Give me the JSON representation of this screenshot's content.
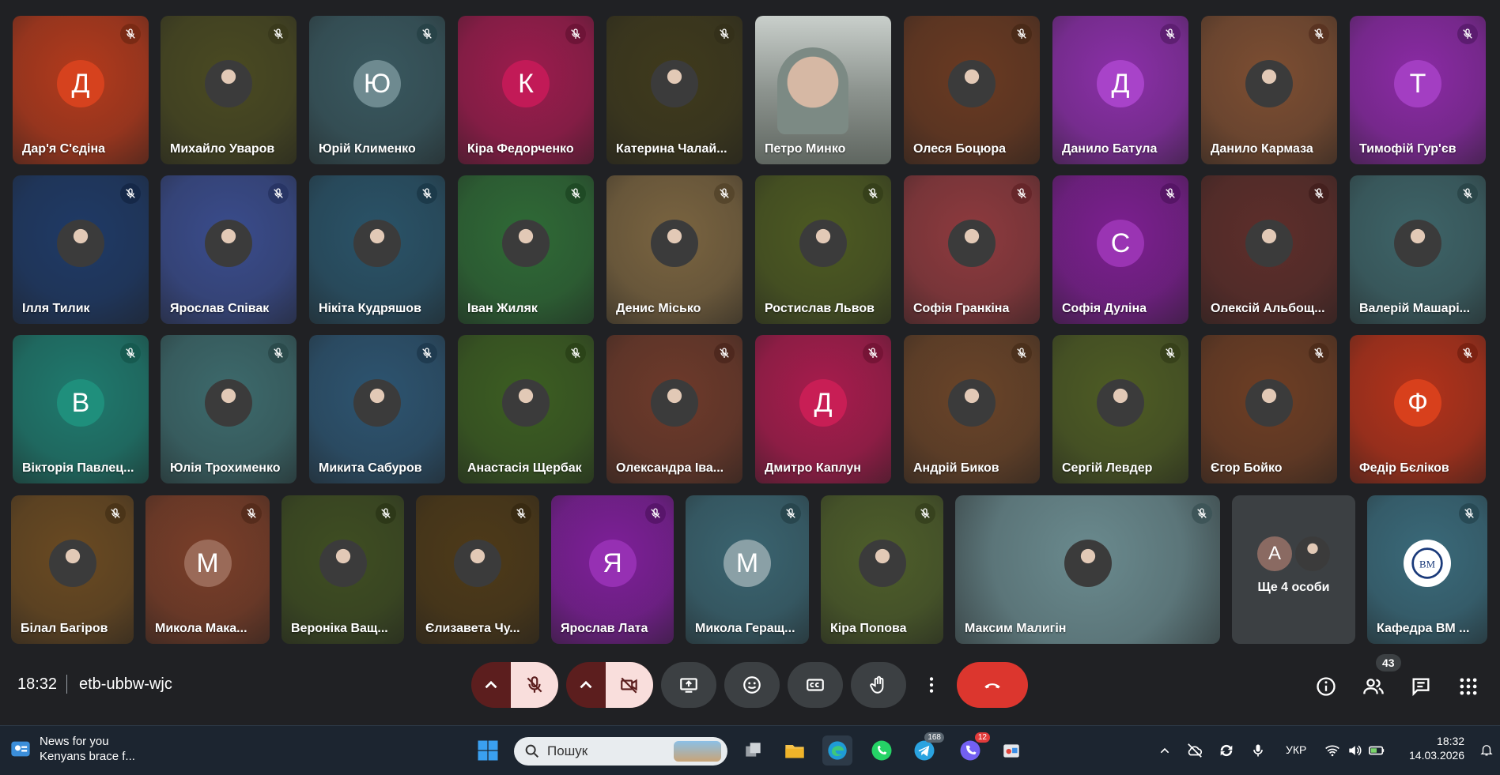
{
  "meeting": {
    "time": "18:32",
    "code": "etb-ubbw-wjc",
    "participant_count": "43",
    "more_people": {
      "label": "Ще 4 особи",
      "initial": "А"
    }
  },
  "rows": [
    [
      {
        "name": "Дар'я С'єдіна",
        "initial": "Д",
        "bg": "#b33a1c",
        "av": "#d6421e",
        "mic": "#7a2a14"
      },
      {
        "name": "Михайло Уваров",
        "initial": "",
        "bg": "#4a4a22",
        "av": "",
        "mic": "#3a3a1c"
      },
      {
        "name": "Юрій Клименко",
        "initial": "Ю",
        "bg": "#39585f",
        "av": "#6e8a90",
        "mic": "#284348"
      },
      {
        "name": "Кіра Федорченко",
        "initial": "К",
        "bg": "#9c1c4d",
        "av": "#c21a57",
        "mic": "#6e1437"
      },
      {
        "name": "Катерина Чалай...",
        "initial": "",
        "bg": "#3f3a1c",
        "av": "",
        "mic": "#34301a"
      },
      {
        "name": "Петро Минко",
        "initial": "",
        "bg": "#9da5a0",
        "av": "",
        "mic": ""
      },
      {
        "name": "Олеся Боцюра",
        "initial": "",
        "bg": "#6a3a22",
        "av": "",
        "mic": "#4a2a18"
      },
      {
        "name": "Данило Батула",
        "initial": "Д",
        "bg": "#8b2fa8",
        "av": "#a843c9",
        "mic": "#5e1f72"
      },
      {
        "name": "Данило Кармаза",
        "initial": "",
        "bg": "#7d4e32",
        "av": "",
        "mic": "#5a3422"
      },
      {
        "name": "Тимофій Гур'єв",
        "initial": "Т",
        "bg": "#8b2aa5",
        "av": "#a33ec2",
        "mic": "#5c1c70"
      }
    ],
    [
      {
        "name": "Ілля Тилик",
        "initial": "",
        "bg": "#1f3a66",
        "av": "",
        "mic": "#152848"
      },
      {
        "name": "Ярослав Співак",
        "initial": "",
        "bg": "#3a4c8c",
        "av": "",
        "mic": "#283565"
      },
      {
        "name": "Нікіта Кудряшов",
        "initial": "",
        "bg": "#2a5368",
        "av": "",
        "mic": "#1c3a4a"
      },
      {
        "name": "Іван Жиляк",
        "initial": "",
        "bg": "#2f6a36",
        "av": "",
        "mic": "#1f4a25"
      },
      {
        "name": "Денис Місько",
        "initial": "",
        "bg": "#7a6440",
        "av": "",
        "mic": "#56462c"
      },
      {
        "name": "Ростислав Львов",
        "initial": "",
        "bg": "#4d5a22",
        "av": "",
        "mic": "#36401a"
      },
      {
        "name": "Софія Гранкіна",
        "initial": "",
        "bg": "#8e3a3e",
        "av": "",
        "mic": "#66262a"
      },
      {
        "name": "Софія Дуліна",
        "initial": "С",
        "bg": "#7c1f90",
        "av": "#9a34b3",
        "mic": "#561566"
      },
      {
        "name": "Олексій Альбощ...",
        "initial": "",
        "bg": "#5e2e2a",
        "av": "",
        "mic": "#44201e"
      },
      {
        "name": "Валерій Машарі...",
        "initial": "",
        "bg": "#3e6468",
        "av": "",
        "mic": "#2b474a"
      }
    ],
    [
      {
        "name": "Вікторія Павлец...",
        "initial": "В",
        "bg": "#1f7a6e",
        "av": "#1f8f7c",
        "mic": "#165a50"
      },
      {
        "name": "Юлія Трохименко",
        "initial": "",
        "bg": "#3d6a6c",
        "av": "",
        "mic": "#2b4b4c"
      },
      {
        "name": "Микита Сабуров",
        "initial": "",
        "bg": "#2d5470",
        "av": "",
        "mic": "#1f3b50"
      },
      {
        "name": "Анастасія Щербак",
        "initial": "",
        "bg": "#3c5e22",
        "av": "",
        "mic": "#2b4318"
      },
      {
        "name": "Олександра Іва...",
        "initial": "",
        "bg": "#6e3a2a",
        "av": "",
        "mic": "#4e281e"
      },
      {
        "name": "Дмитро Каплун",
        "initial": "Д",
        "bg": "#a81c4d",
        "av": "#c81e55",
        "mic": "#761436"
      },
      {
        "name": "Андрій Биков",
        "initial": "",
        "bg": "#6a4428",
        "av": "",
        "mic": "#4b301c"
      },
      {
        "name": "Сергій Левдер",
        "initial": "",
        "bg": "#4e5c24",
        "av": "",
        "mic": "#37411a"
      },
      {
        "name": "Єгор Бойко",
        "initial": "",
        "bg": "#6e3e24",
        "av": "",
        "mic": "#4e2c1a"
      },
      {
        "name": "Федір Бєліков",
        "initial": "Ф",
        "bg": "#b3321a",
        "av": "#d8401c",
        "mic": "#7c2212"
      }
    ],
    [
      {
        "name": "Білал Багіров",
        "initial": "",
        "bg": "#6a4a22",
        "av": "",
        "mic": "#4a3418"
      },
      {
        "name": "Микола Мака...",
        "initial": "М",
        "bg": "#7a3e28",
        "av": "#9a6a58",
        "mic": "#562c1c"
      },
      {
        "name": "Вероніка Ващ...",
        "initial": "",
        "bg": "#3f4e22",
        "av": "",
        "mic": "#2d3818"
      },
      {
        "name": "Єлизавета Чу...",
        "initial": "",
        "bg": "#4e3a18",
        "av": "",
        "mic": "#382a12"
      },
      {
        "name": "Ярослав Лата",
        "initial": "Я",
        "bg": "#7e1f99",
        "av": "#9630b3",
        "mic": "#58156b"
      },
      {
        "name": "Микола Геращ...",
        "initial": "М",
        "bg": "#3a6470",
        "av": "#8aa0a6",
        "mic": "#28464e"
      },
      {
        "name": "Кіра Попова",
        "initial": "",
        "bg": "#4e5e2a",
        "av": "",
        "mic": "#37421e"
      },
      {
        "name": "Максим Малигін",
        "initial": "",
        "bg": "#6a8a8e",
        "av": "",
        "mic": "#3e5558"
      },
      {
        "name": "Кафедра ВМ ...",
        "initial": "",
        "bg": "#3a6a7a",
        "av": "",
        "mic": "#284a55"
      }
    ]
  ],
  "controls": {
    "mic_state": "muted",
    "camera_state": "off"
  },
  "taskbar": {
    "news_title": "News for you",
    "news_sub": "Kenyans brace f...",
    "search_placeholder": "Пошук",
    "telegram_badge": "168",
    "viber_badge": "12",
    "language": "УКР",
    "time": "18:32",
    "date": "14.03.2026"
  }
}
